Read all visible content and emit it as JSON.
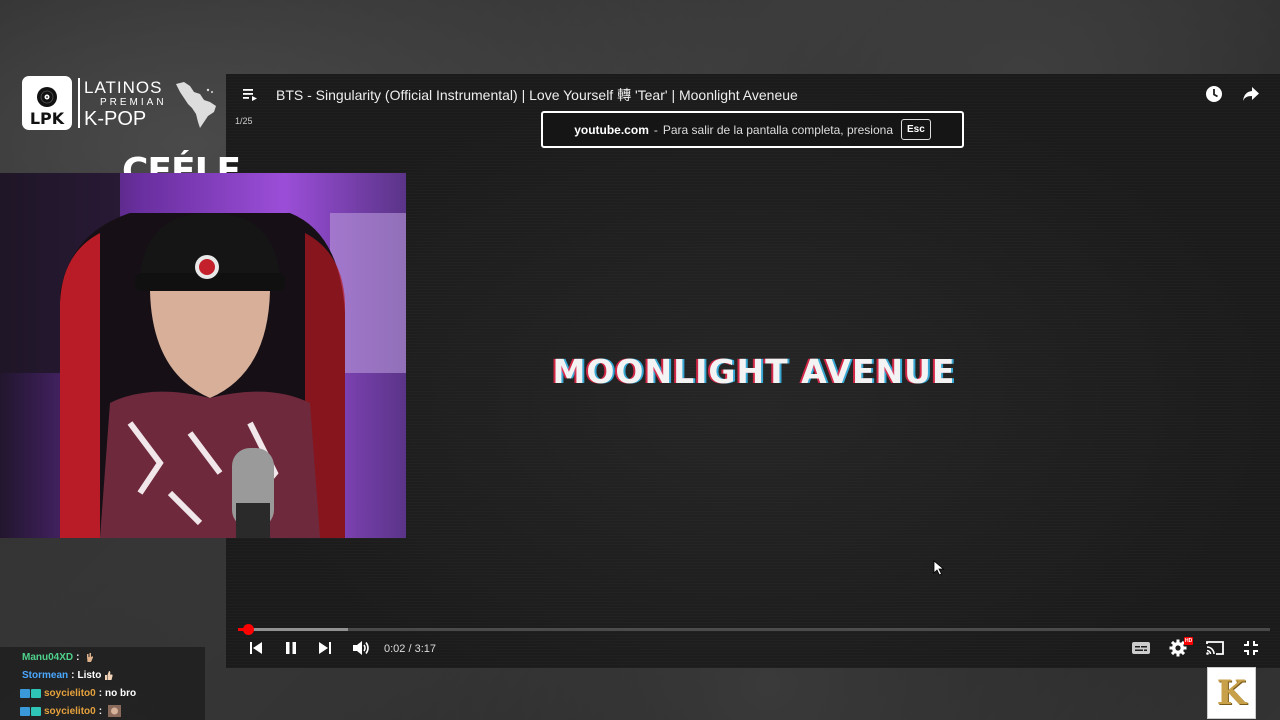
{
  "player": {
    "title": "BTS - Singularity (Official Instrumental) | Love Yourself 轉 'Tear' | Moonlight Aveneue",
    "playlist_index": "1/25",
    "time": "0:02 / 3:17",
    "progress_fraction": 0.01,
    "buffered_fraction": 0.107,
    "hd_badge": "HD",
    "fullscreen_notice": {
      "domain": "youtube.com",
      "separator": "-",
      "message": "Para salir de la pantalla completa, presiona",
      "key": "Esc"
    },
    "video_text": "MOONLIGHT AVENUE"
  },
  "overlay": {
    "lpk_badge": "LPK",
    "logo_line1": "LATINOS",
    "logo_line2": "PREMIAN",
    "logo_line3": "K-POP",
    "streamer_name": "CEÉLE",
    "corner_logo": "K"
  },
  "chat": [
    {
      "user": "Manu04XD",
      "user_color": "#4fd18b",
      "message": "",
      "badges": false,
      "emote": "hand"
    },
    {
      "user": "Stormean",
      "user_color": "#4aa8ff",
      "message": "Listo",
      "badges": false,
      "emote": "thumb"
    },
    {
      "user": "soycielito0",
      "user_color": "#e6a23c",
      "message": "no bro",
      "badges": true,
      "emote": ""
    },
    {
      "user": "soycielito0",
      "user_color": "#e6a23c",
      "message": "",
      "badges": true,
      "emote": "face"
    }
  ],
  "colors": {
    "accent": "#ff0000",
    "chat_badge_1": "#3a9ad9",
    "chat_badge_2": "#2ec4b6"
  }
}
